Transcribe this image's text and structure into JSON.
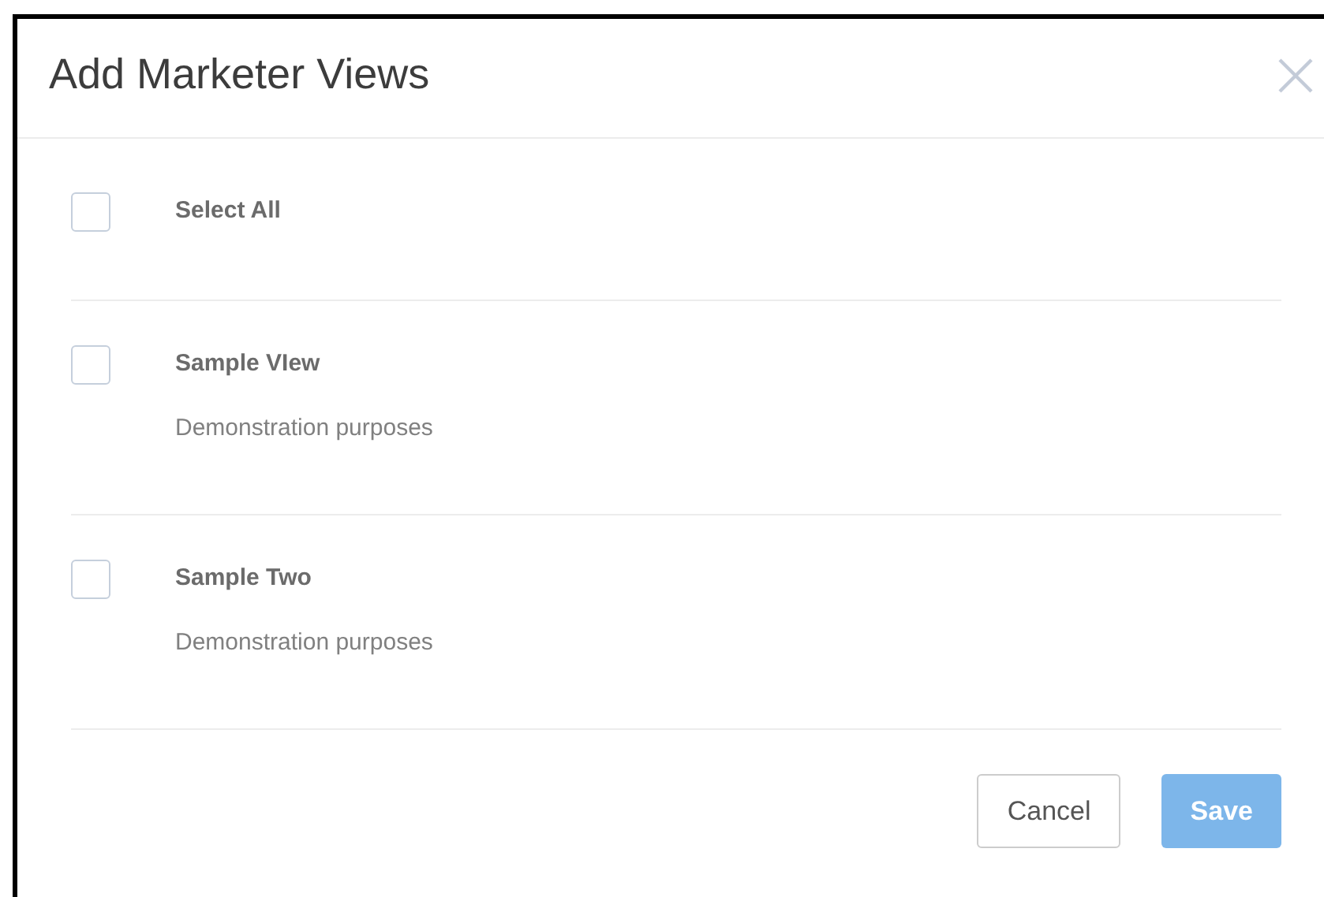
{
  "dialog": {
    "title": "Add Marketer Views"
  },
  "select_all": {
    "label": "Select All",
    "checked": false
  },
  "items": [
    {
      "name": "Sample VIew",
      "description": "Demonstration purposes",
      "checked": false
    },
    {
      "name": "Sample Two",
      "description": "Demonstration purposes",
      "checked": false
    }
  ],
  "buttons": [
    {
      "label": "Cancel",
      "kind": "secondary",
      "disabled": false
    },
    {
      "label": "Save",
      "kind": "primary",
      "disabled": true
    }
  ]
}
